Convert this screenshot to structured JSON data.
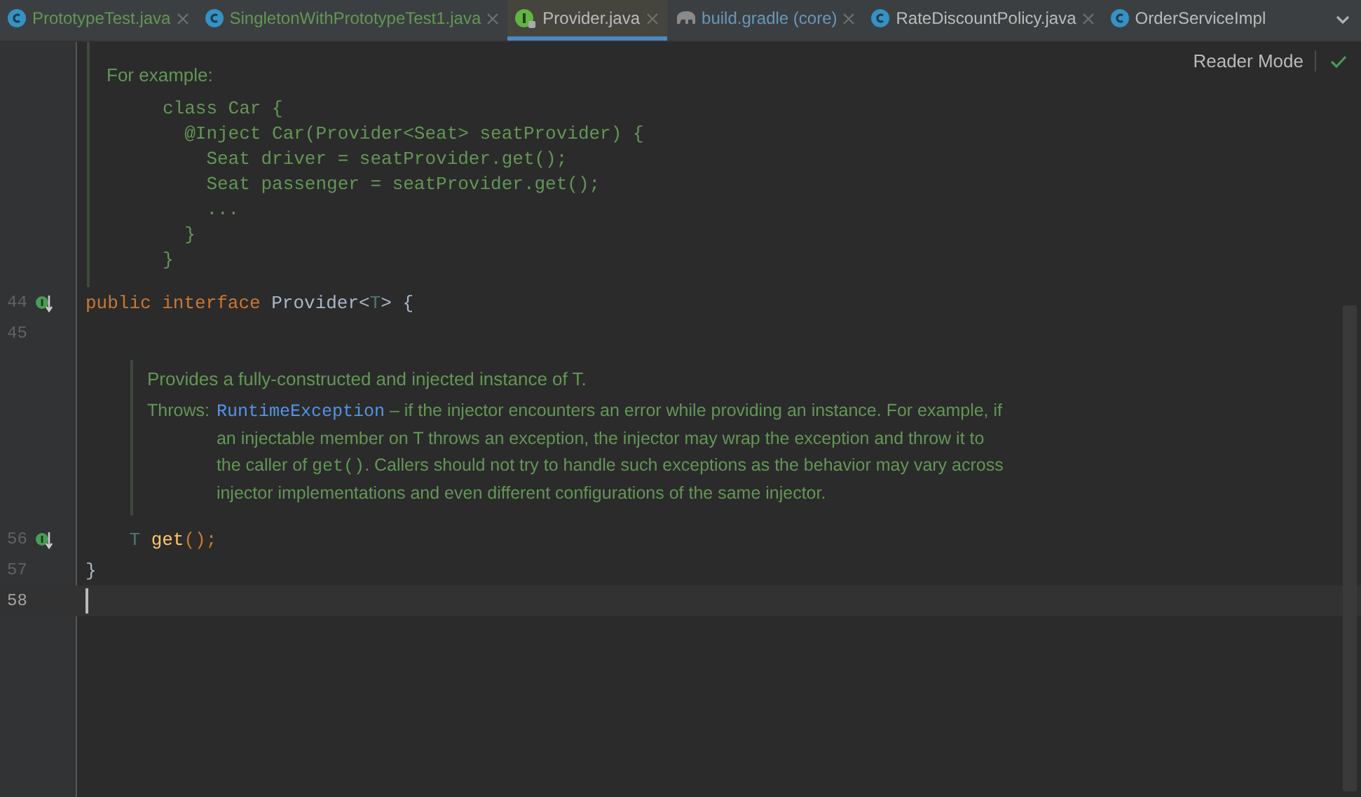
{
  "tabs": [
    {
      "label": "PrototypeTest.java",
      "kind": "class",
      "color": "#629755",
      "selected": false
    },
    {
      "label": "SingletonWithPrototypeTest1.java",
      "kind": "class",
      "color": "#629755",
      "selected": false
    },
    {
      "label": "Provider.java",
      "kind": "interface",
      "color": "#bbbbbb",
      "selected": true
    },
    {
      "label": "build.gradle (core)",
      "kind": "gradle",
      "color": "#6897bb",
      "selected": false
    },
    {
      "label": "RateDiscountPolicy.java",
      "kind": "class",
      "color": "#bbbbbb",
      "selected": false
    },
    {
      "label": "OrderServiceImpl",
      "kind": "class",
      "color": "#bbbbbb",
      "selected": false
    }
  ],
  "reader_mode": "Reader Mode",
  "blocks": [
    {
      "kind": "doc",
      "paragraph": "For example:",
      "code": [
        "class Car {",
        "  @Inject Car(Provider<Seat> seatProvider) {",
        "    Seat driver = seatProvider.get();",
        "    Seat passenger = seatProvider.get();",
        "    ...",
        "  }",
        "}"
      ]
    },
    {
      "kind": "line",
      "number": "44",
      "marker": true,
      "current": false,
      "tokens": [
        {
          "text": "public interface ",
          "kind": "keyword"
        },
        {
          "text": "Provider<",
          "kind": "plain"
        },
        {
          "text": "T",
          "kind": "param"
        },
        {
          "text": "> {",
          "kind": "plain"
        }
      ]
    },
    {
      "kind": "line",
      "number": "45",
      "marker": false,
      "current": false
    },
    {
      "kind": "doc2",
      "summary": "Provides a fully-constructed and injected instance of T.",
      "throws_label": "Throws:",
      "exception": "RuntimeException",
      "parts": [
        {
          "text": " – if the injector encounters an error while providing an instance. For example, if an injectable member on T throws an exception, the injector may wrap the exception and throw it to the caller of ",
          "kind": "text"
        },
        {
          "text": "get()",
          "kind": "code"
        },
        {
          "text": ". Callers should not try to handle such exceptions as the behavior may vary across injector implementations and even different configurations of the same injector.",
          "kind": "text"
        }
      ]
    },
    {
      "kind": "line",
      "number": "56",
      "marker": true,
      "current": false,
      "tokens": [
        {
          "text": "    T",
          "kind": "param"
        },
        {
          "text": " get",
          "kind": "method"
        },
        {
          "text": "();",
          "kind": "keyword"
        }
      ]
    },
    {
      "kind": "line",
      "number": "57",
      "marker": false,
      "current": false,
      "tokens": [
        {
          "text": "}",
          "kind": "plain"
        }
      ]
    },
    {
      "kind": "line",
      "number": "58",
      "marker": false,
      "current": true
    }
  ]
}
